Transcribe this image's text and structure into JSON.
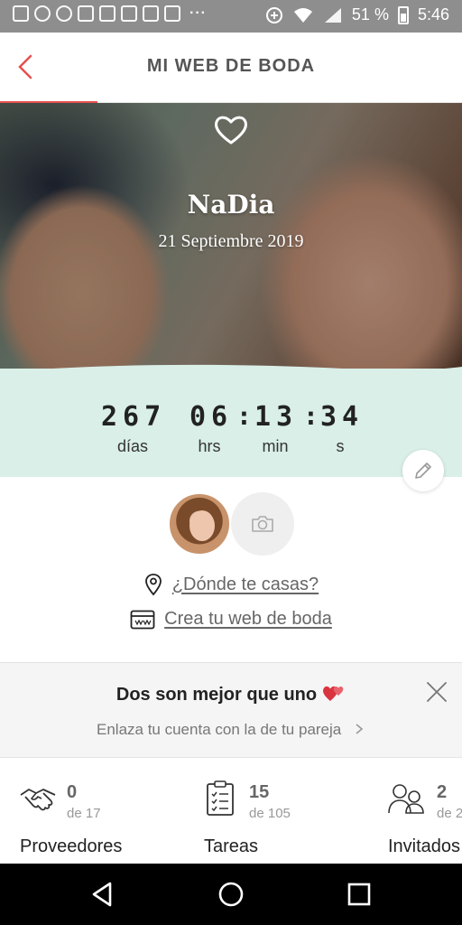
{
  "status_bar": {
    "battery": "51 %",
    "time": "5:46",
    "overflow": "···"
  },
  "app_bar": {
    "title": "MI WEB DE BODA"
  },
  "hero": {
    "couple_name": "NaDia",
    "date": "21 Septiembre 2019"
  },
  "countdown": {
    "days": "267",
    "hours": "06",
    "minutes": "13",
    "seconds": "34",
    "days_label": "días",
    "hours_label": "hrs",
    "minutes_label": "min",
    "seconds_label": "s"
  },
  "profile": {
    "location_link": "¿Dónde te casas?",
    "web_link": "Crea tu web de boda"
  },
  "banner": {
    "title": "Dos son mejor que uno",
    "subtitle": "Enlaza tu cuenta con la de tu pareja"
  },
  "stats": [
    {
      "count": "0",
      "of": "de 17",
      "label": "Proveedores",
      "icon": "handshake-icon"
    },
    {
      "count": "15",
      "of": "de 105",
      "label": "Tareas",
      "icon": "clipboard-checklist-icon"
    },
    {
      "count": "2",
      "of": "de 2",
      "label": "Invitados",
      "icon": "guests-icon"
    }
  ],
  "colors": {
    "accent": "#e6504e",
    "countdown_bg": "#d9efe8",
    "banner_bg": "#f5f5f5"
  }
}
